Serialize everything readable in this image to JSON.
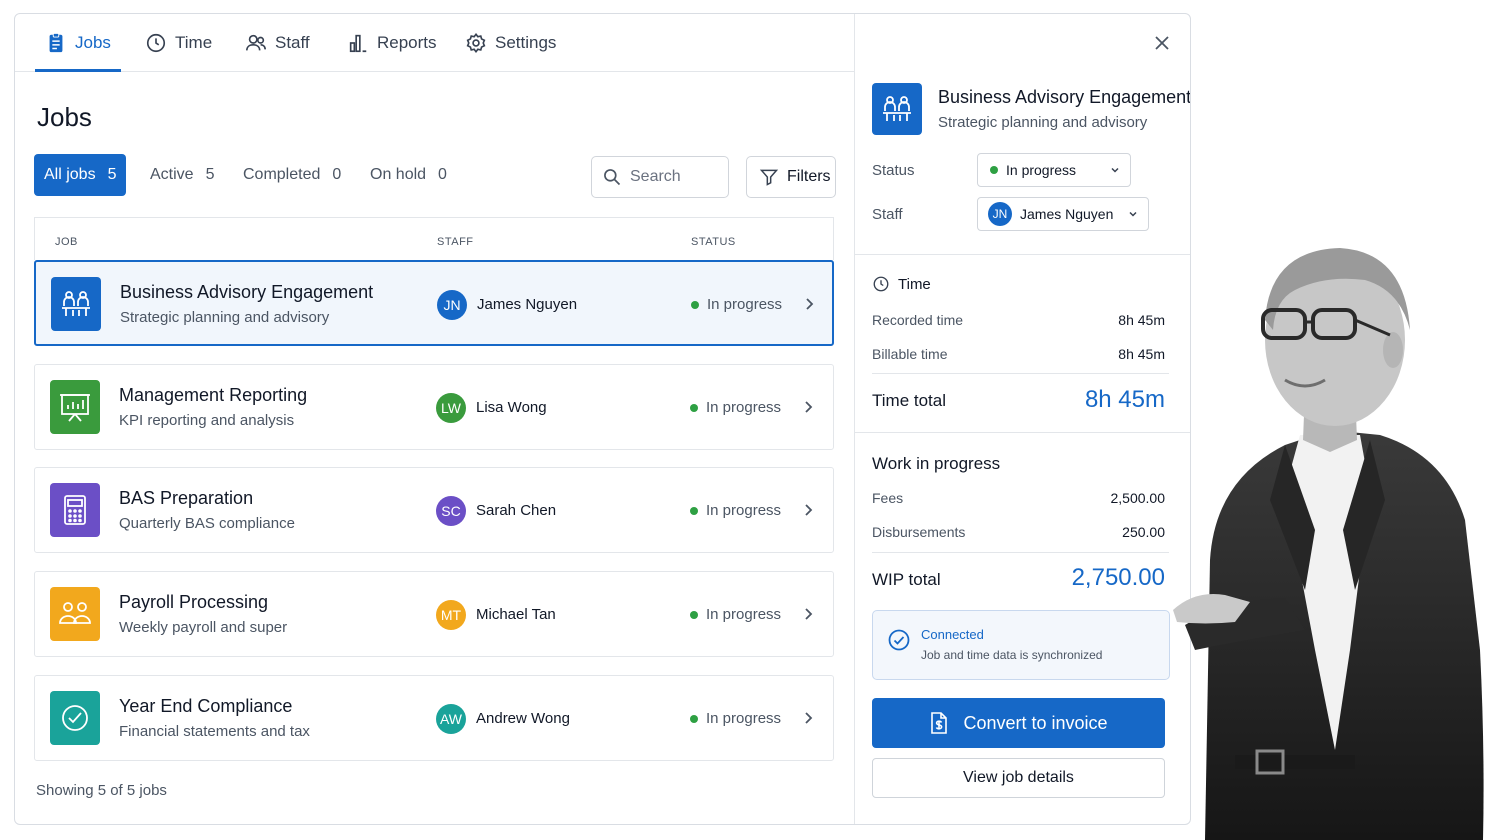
{
  "nav": {
    "items": [
      {
        "label": "Jobs",
        "icon": "clipboard-icon",
        "active": true
      },
      {
        "label": "Time",
        "icon": "clock-icon",
        "active": false
      },
      {
        "label": "Staff",
        "icon": "users-icon",
        "active": false
      },
      {
        "label": "Reports",
        "icon": "bar-chart-icon",
        "active": false
      },
      {
        "label": "Settings",
        "icon": "gear-icon",
        "active": false
      }
    ]
  },
  "page_title": "Jobs",
  "filters": {
    "tabs": [
      {
        "label": "All jobs",
        "count": "5",
        "active": true
      },
      {
        "label": "Active",
        "count": "5",
        "active": false
      },
      {
        "label": "Completed",
        "count": "0",
        "active": false
      },
      {
        "label": "On hold",
        "count": "0",
        "active": false
      }
    ],
    "search_placeholder": "Search",
    "filters_label": "Filters"
  },
  "table": {
    "columns": [
      "JOB",
      "STAFF",
      "STATUS"
    ],
    "rows": [
      {
        "title": "Business Advisory Engagement",
        "subtitle": "Strategic planning and advisory",
        "icon": "people-meeting-icon",
        "icon_color": "#1668c7",
        "initials": "JN",
        "avatar_color": "#1668c7",
        "staff": "James Nguyen",
        "status": "In progress"
      },
      {
        "title": "Management Reporting",
        "subtitle": "KPI reporting and analysis",
        "icon": "presentation-chart-icon",
        "icon_color": "#3a9b3d",
        "initials": "LW",
        "avatar_color": "#3a9b3d",
        "staff": "Lisa Wong",
        "status": "In progress"
      },
      {
        "title": "BAS Preparation",
        "subtitle": "Quarterly BAS compliance",
        "icon": "calculator-icon",
        "icon_color": "#6b4fc6",
        "initials": "SC",
        "avatar_color": "#6b4fc6",
        "staff": "Sarah Chen",
        "status": "In progress"
      },
      {
        "title": "Payroll Processing",
        "subtitle": "Weekly payroll and super",
        "icon": "group-icon",
        "icon_color": "#f2a81d",
        "initials": "MT",
        "avatar_color": "#f2a81d",
        "staff": "Michael Tan",
        "status": "In progress"
      },
      {
        "title": "Year End Compliance",
        "subtitle": "Financial statements and tax",
        "icon": "check-circle-icon",
        "icon_color": "#1aa39a",
        "initials": "AW",
        "avatar_color": "#1aa39a",
        "staff": "Andrew Wong",
        "status": "In progress"
      }
    ],
    "status_color": "#2ea043"
  },
  "footer": {
    "showing": "Showing 5 of 5 jobs"
  },
  "detail": {
    "title": "Business Advisory Engagement",
    "subtitle": "Strategic planning and advisory",
    "status_label": "Status",
    "status_value": "In progress",
    "staff_label": "Staff",
    "staff_initials": "JN",
    "staff_value": "James Nguyen",
    "time": {
      "heading": "Time",
      "recorded_label": "Recorded time",
      "recorded_value": "8h 45m",
      "billable_label": "Billable time",
      "billable_value": "8h 45m",
      "total_label": "Time total",
      "total_value": "8h 45m"
    },
    "wip": {
      "heading": "Work in progress",
      "fees_label": "Fees",
      "fees_value": "2,500.00",
      "disb_label": "Disbursements",
      "disb_value": "250.00",
      "total_label": "WIP total",
      "total_value": "2,750.00"
    },
    "connection": {
      "title": "Connected",
      "text": "Job and time data is synchronized"
    },
    "convert_label": "Convert to invoice",
    "view_label": "View job details"
  },
  "accent_color": "#1668c7"
}
